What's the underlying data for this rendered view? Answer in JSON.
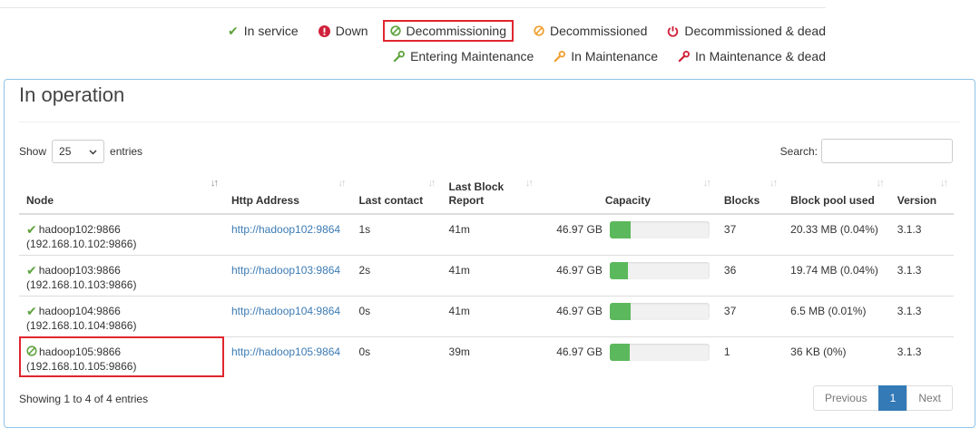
{
  "legend": {
    "row1": [
      {
        "label": "In service",
        "icon": "check-icon",
        "color": "#5fa33e"
      },
      {
        "label": "Down",
        "icon": "exclamation-circle-icon",
        "color": "#d0213a"
      },
      {
        "label": "Decommissioning",
        "icon": "ban-icon",
        "color": "#5fa33e"
      },
      {
        "label": "Decommissioned",
        "icon": "ban-icon",
        "color": "#f0a031"
      },
      {
        "label": "Decommissioned & dead",
        "icon": "power-icon",
        "color": "#d0213a"
      }
    ],
    "row2": [
      {
        "label": "Entering Maintenance",
        "icon": "wrench-icon",
        "color": "#5fa33e"
      },
      {
        "label": "In Maintenance",
        "icon": "wrench-icon",
        "color": "#f0a031"
      },
      {
        "label": "In Maintenance & dead",
        "icon": "wrench-icon",
        "color": "#d0213a"
      }
    ]
  },
  "panel": {
    "title": "In operation",
    "show_label": "Show",
    "entries_value": "25",
    "entries_label": "entries",
    "search_label": "Search:"
  },
  "table": {
    "headers": {
      "node": "Node",
      "http": "Http Address",
      "last_contact": "Last contact",
      "last_block": "Last Block Report",
      "capacity": "Capacity",
      "blocks": "Blocks",
      "pool": "Block pool used",
      "version": "Version"
    },
    "rows": [
      {
        "status_icon": "check-icon",
        "name": "hadoop102:9866",
        "ip": "(192.168.10.102:9866)",
        "http": "http://hadoop102:9864",
        "last_contact": "1s",
        "last_block": "41m",
        "capacity": "46.97 GB",
        "used_fraction": 0.21,
        "blocks": "37",
        "pool": "20.33 MB (0.04%)",
        "version": "3.1.3"
      },
      {
        "status_icon": "check-icon",
        "name": "hadoop103:9866",
        "ip": "(192.168.10.103:9866)",
        "http": "http://hadoop103:9864",
        "last_contact": "2s",
        "last_block": "41m",
        "capacity": "46.97 GB",
        "used_fraction": 0.18,
        "blocks": "36",
        "pool": "19.74 MB (0.04%)",
        "version": "3.1.3"
      },
      {
        "status_icon": "check-icon",
        "name": "hadoop104:9866",
        "ip": "(192.168.10.104:9866)",
        "http": "http://hadoop104:9864",
        "last_contact": "0s",
        "last_block": "41m",
        "capacity": "46.97 GB",
        "used_fraction": 0.21,
        "blocks": "37",
        "pool": "6.5 MB (0.01%)",
        "version": "3.1.3"
      },
      {
        "status_icon": "ban-icon",
        "name": "hadoop105:9866",
        "ip": "(192.168.10.105:9866)",
        "http": "http://hadoop105:9864",
        "last_contact": "0s",
        "last_block": "39m",
        "capacity": "46.97 GB",
        "used_fraction": 0.2,
        "blocks": "1",
        "pool": "36 KB (0%)",
        "version": "3.1.3"
      }
    ]
  },
  "footer": {
    "info": "Showing 1 to 4 of 4 entries",
    "previous": "Previous",
    "page": "1",
    "next": "Next"
  }
}
